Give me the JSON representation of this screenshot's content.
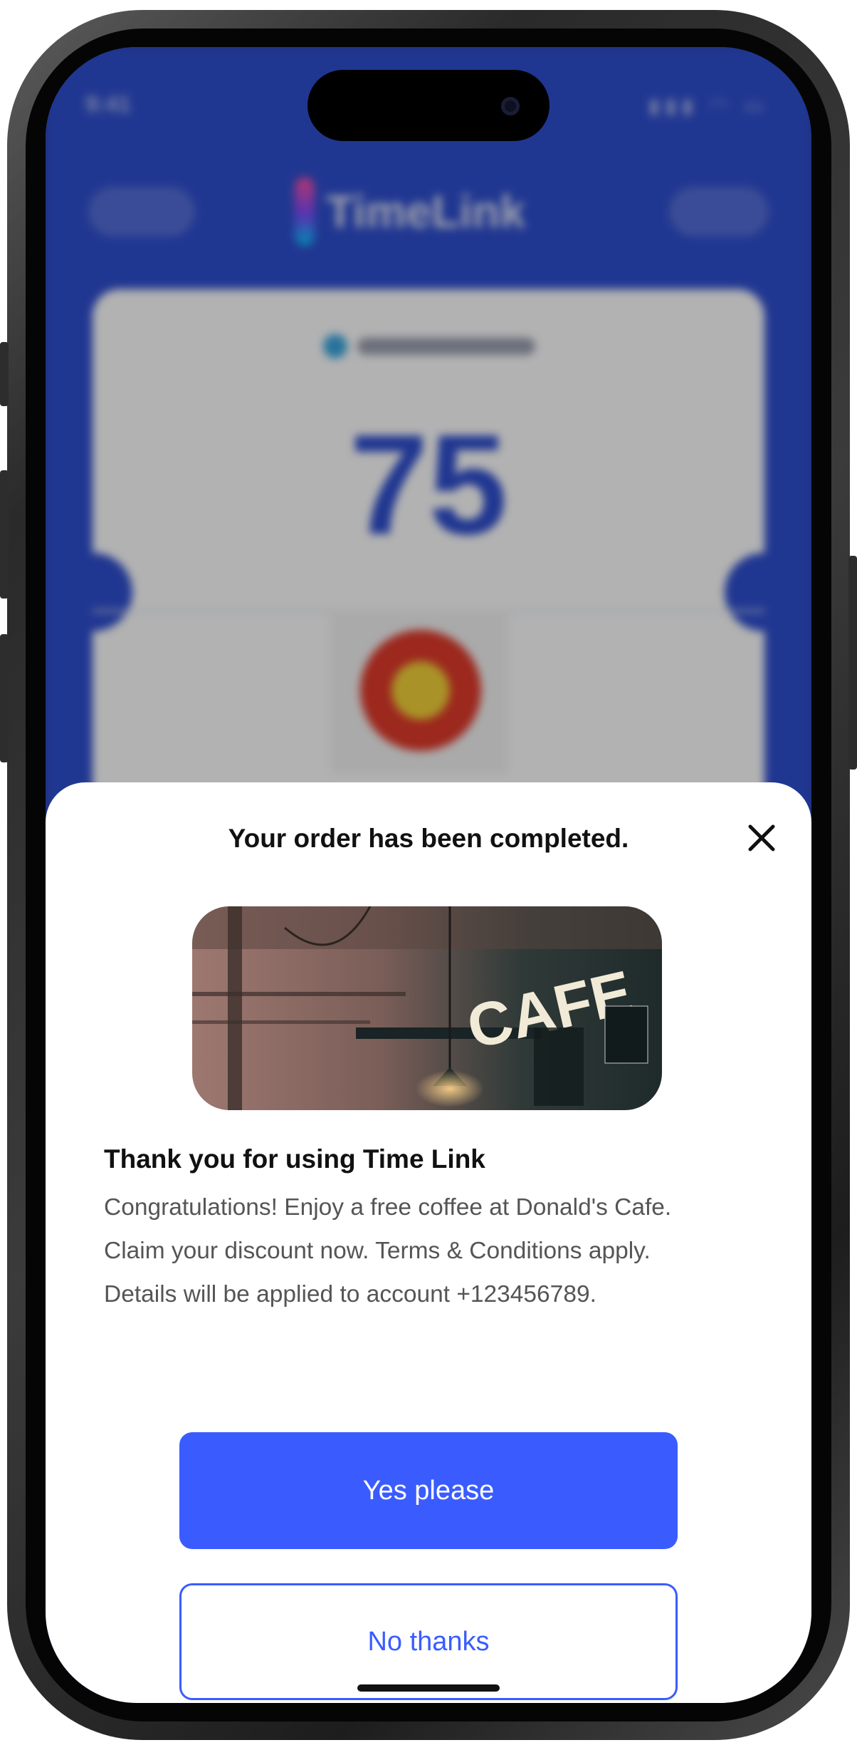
{
  "status_bar": {
    "time": "9:41"
  },
  "app_header": {
    "brand": "TimeLink",
    "brand_gradient": [
      "#ff4fa0",
      "#7a4cff",
      "#00c8ff"
    ]
  },
  "points_card": {
    "points": "75"
  },
  "modal": {
    "title": "Your order has been completed.",
    "close_icon": "close-icon",
    "image_text": "CAFE",
    "heading": "Thank you for using Time Link",
    "body_lines": [
      "Congratulations! Enjoy a free coffee at Donald's Cafe.",
      "Claim your discount now. Terms & Conditions apply.",
      "Details will be applied to account +123456789."
    ],
    "primary_button": "Yes please",
    "secondary_button": "No thanks"
  },
  "colors": {
    "app_blue": "#2f4fd0",
    "button_blue": "#3a5cff",
    "text_dark": "#111111",
    "text_body": "#555555"
  }
}
